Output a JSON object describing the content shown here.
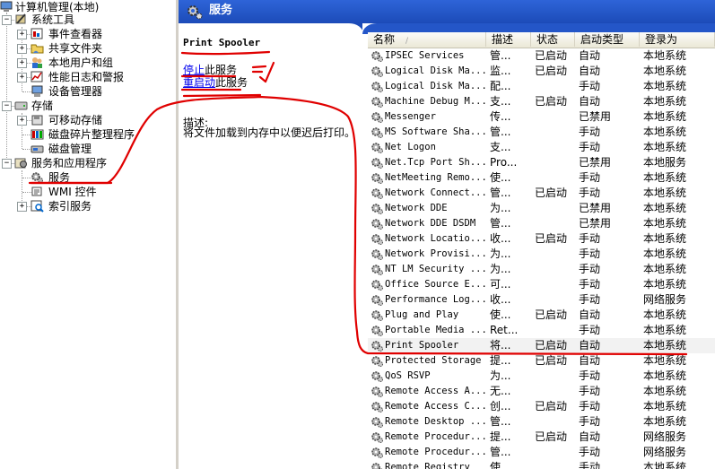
{
  "tree": {
    "root": "计算机管理(本地)",
    "system_tools": "系统工具",
    "event_viewer": "事件查看器",
    "shared_folders": "共享文件夹",
    "local_users": "本地用户和组",
    "perf_logs": "性能日志和警报",
    "device_manager": "设备管理器",
    "storage": "存储",
    "removable_storage": "可移动存储",
    "defrag": "磁盘碎片整理程序",
    "disk_mgmt": "磁盘管理",
    "services_apps": "服务和应用程序",
    "services": "服务",
    "wmi": "WMI 控件",
    "indexing": "索引服务"
  },
  "header": {
    "title": "服务"
  },
  "detail": {
    "service_name": "Print Spooler",
    "stop_link": "停止",
    "stop_suffix": "此服务",
    "restart_link": "重启动",
    "restart_suffix": "此服务",
    "desc_label": "描述:",
    "desc_text": "将文件加载到内存中以便迟后打印。"
  },
  "columns": {
    "name": "名称",
    "desc": "描述",
    "status": "状态",
    "startup": "启动类型",
    "logon": "登录为",
    "sort_indicator": "/"
  },
  "rows": [
    {
      "name": "IPSEC Services",
      "desc": "管...",
      "status": "已启动",
      "startup": "自动",
      "logon": "本地系统"
    },
    {
      "name": "Logical Disk Ma...",
      "desc": "监...",
      "status": "已启动",
      "startup": "自动",
      "logon": "本地系统"
    },
    {
      "name": "Logical Disk Ma...",
      "desc": "配...",
      "status": "",
      "startup": "手动",
      "logon": "本地系统"
    },
    {
      "name": "Machine Debug M...",
      "desc": "支...",
      "status": "已启动",
      "startup": "自动",
      "logon": "本地系统"
    },
    {
      "name": "Messenger",
      "desc": "传...",
      "status": "",
      "startup": "已禁用",
      "logon": "本地系统"
    },
    {
      "name": "MS Software Sha...",
      "desc": "管...",
      "status": "",
      "startup": "手动",
      "logon": "本地系统"
    },
    {
      "name": "Net Logon",
      "desc": "支...",
      "status": "",
      "startup": "手动",
      "logon": "本地系统"
    },
    {
      "name": "Net.Tcp Port Sh...",
      "desc": "Pro...",
      "status": "",
      "startup": "已禁用",
      "logon": "本地服务"
    },
    {
      "name": "NetMeeting Remo...",
      "desc": "使...",
      "status": "",
      "startup": "手动",
      "logon": "本地系统"
    },
    {
      "name": "Network Connect...",
      "desc": "管...",
      "status": "已启动",
      "startup": "手动",
      "logon": "本地系统"
    },
    {
      "name": "Network DDE",
      "desc": "为...",
      "status": "",
      "startup": "已禁用",
      "logon": "本地系统"
    },
    {
      "name": "Network DDE DSDM",
      "desc": "管...",
      "status": "",
      "startup": "已禁用",
      "logon": "本地系统"
    },
    {
      "name": "Network Locatio...",
      "desc": "收...",
      "status": "已启动",
      "startup": "手动",
      "logon": "本地系统"
    },
    {
      "name": "Network Provisi...",
      "desc": "为...",
      "status": "",
      "startup": "手动",
      "logon": "本地系统"
    },
    {
      "name": "NT LM Security ...",
      "desc": "为...",
      "status": "",
      "startup": "手动",
      "logon": "本地系统"
    },
    {
      "name": "Office Source E...",
      "desc": "可...",
      "status": "",
      "startup": "手动",
      "logon": "本地系统"
    },
    {
      "name": "Performance Log...",
      "desc": "收...",
      "status": "",
      "startup": "手动",
      "logon": "网络服务"
    },
    {
      "name": "Plug and Play",
      "desc": "使...",
      "status": "已启动",
      "startup": "自动",
      "logon": "本地系统"
    },
    {
      "name": "Portable Media ...",
      "desc": "Ret...",
      "status": "",
      "startup": "手动",
      "logon": "本地系统"
    },
    {
      "name": "Print Spooler",
      "desc": "将...",
      "status": "已启动",
      "startup": "自动",
      "logon": "本地系统"
    },
    {
      "name": "Protected Storage",
      "desc": "提...",
      "status": "已启动",
      "startup": "自动",
      "logon": "本地系统"
    },
    {
      "name": "QoS RSVP",
      "desc": "为...",
      "status": "",
      "startup": "手动",
      "logon": "本地系统"
    },
    {
      "name": "Remote Access A...",
      "desc": "无...",
      "status": "",
      "startup": "手动",
      "logon": "本地系统"
    },
    {
      "name": "Remote Access C...",
      "desc": "创...",
      "status": "已启动",
      "startup": "手动",
      "logon": "本地系统"
    },
    {
      "name": "Remote Desktop ...",
      "desc": "管...",
      "status": "",
      "startup": "手动",
      "logon": "本地系统"
    },
    {
      "name": "Remote Procedur...",
      "desc": "提...",
      "status": "已启动",
      "startup": "自动",
      "logon": "网络服务"
    },
    {
      "name": "Remote Procedur...",
      "desc": "管...",
      "status": "",
      "startup": "手动",
      "logon": "网络服务"
    },
    {
      "name": "Remote Registry",
      "desc": "使...",
      "status": "",
      "startup": "手动",
      "logon": "本地系统"
    }
  ],
  "selected_row": 19,
  "colors": {
    "header_blue": "#1c4bb8",
    "link": "#0000ee",
    "annotation_red": "#e00000"
  }
}
